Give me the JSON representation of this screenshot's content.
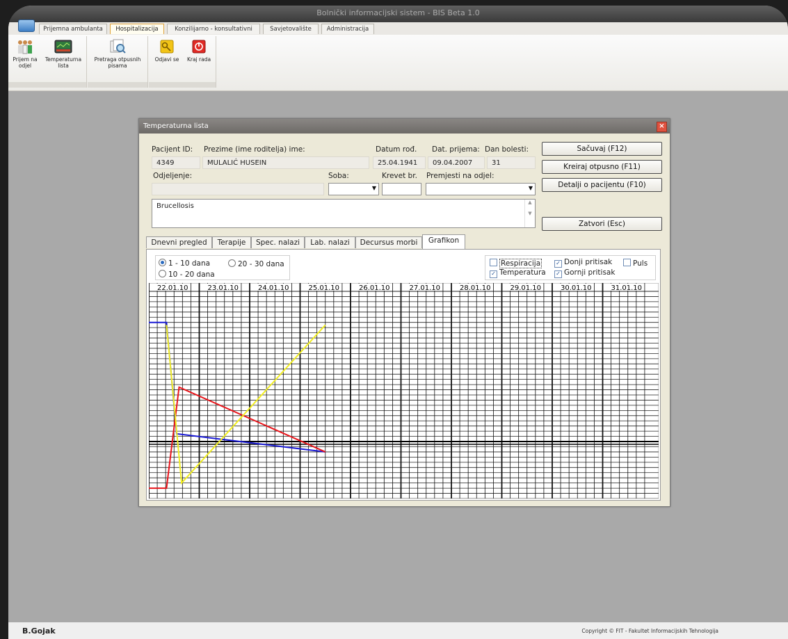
{
  "window": {
    "title": "Bolnički informacijski sistem - BIS Beta 1.0"
  },
  "menu_tabs": [
    "Prijemna ambulanta",
    "Hospitalizacija",
    "Konzilijarno - konsultativni",
    "Savjetovalište",
    "Administracija"
  ],
  "ribbon": {
    "items": [
      {
        "label": "Prijem na odjel"
      },
      {
        "label": "Temperaturna lista"
      },
      {
        "label": "Pretraga otpusnih pisama"
      },
      {
        "label": "Odjavi se"
      },
      {
        "label": "Kraj rada"
      }
    ]
  },
  "dialog": {
    "title": "Temperaturna lista",
    "labels": {
      "patient_id": "Pacijent ID:",
      "name": "Prezime (ime roditelja) ime:",
      "dob": "Datum rođ.",
      "admission": "Dat. prijema:",
      "day": "Dan bolesti:",
      "department": "Odjeljenje:",
      "room": "Soba:",
      "bed": "Krevet br.",
      "transfer": "Premjesti na odjel:"
    },
    "values": {
      "patient_id": "4349",
      "name": "MULALIĆ HUSEIN",
      "dob": "25.04.1941",
      "admission": "09.04.2007",
      "day": "31",
      "department": "",
      "diagnosis": "Brucellosis"
    },
    "buttons": {
      "save": "Sačuvaj (F12)",
      "discharge": "Kreiraj otpusno (F11)",
      "details": "Detalji o pacijentu (F10)",
      "close": "Zatvori (Esc)"
    },
    "tabs": [
      "Dnevni pregled",
      "Terapije",
      "Spec. nalazi",
      "Lab. nalazi",
      "Decursus morbi",
      "Grafikon"
    ],
    "range_options": [
      "1 - 10 dana",
      "20 - 30 dana",
      "10 - 20 dana"
    ],
    "selected_range": "1 - 10 dana",
    "series_toggles": [
      {
        "label": "Respiracija",
        "checked": false
      },
      {
        "label": "Donji pritisak",
        "checked": true
      },
      {
        "label": "Puls",
        "checked": false
      },
      {
        "label": "Temperatura",
        "checked": true
      },
      {
        "label": "Gornji pritisak",
        "checked": true
      }
    ]
  },
  "colors": {
    "red": "#e8141a",
    "blue": "#1a1ad6",
    "yellow": "#f2ee22"
  },
  "chart_data": {
    "type": "line",
    "x": [
      "22.01.10",
      "23.01.10",
      "24.01.10",
      "25.01.10",
      "26.01.10",
      "27.01.10",
      "28.01.10",
      "29.01.10",
      "30.01.10",
      "31.01.10"
    ],
    "ylim": [
      0,
      40
    ],
    "baseline": 11,
    "series": [
      {
        "color": "#1a1ad6",
        "points": [
          [
            0.0,
            34
          ],
          [
            0.35,
            34
          ],
          [
            0.55,
            12.5
          ],
          [
            3.5,
            9
          ]
        ]
      },
      {
        "color": "#e8141a",
        "points": [
          [
            0.0,
            2
          ],
          [
            0.35,
            2
          ],
          [
            0.6,
            21.5
          ],
          [
            3.5,
            9
          ]
        ]
      },
      {
        "color": "#f2ee22",
        "points": [
          [
            0.35,
            33.5
          ],
          [
            0.65,
            3
          ],
          [
            3.5,
            33.5
          ]
        ]
      }
    ]
  },
  "footer": {
    "left": "B.Gojak",
    "right": "Copyright © FIT - Fakultet Informacijskih Tehnologija"
  }
}
